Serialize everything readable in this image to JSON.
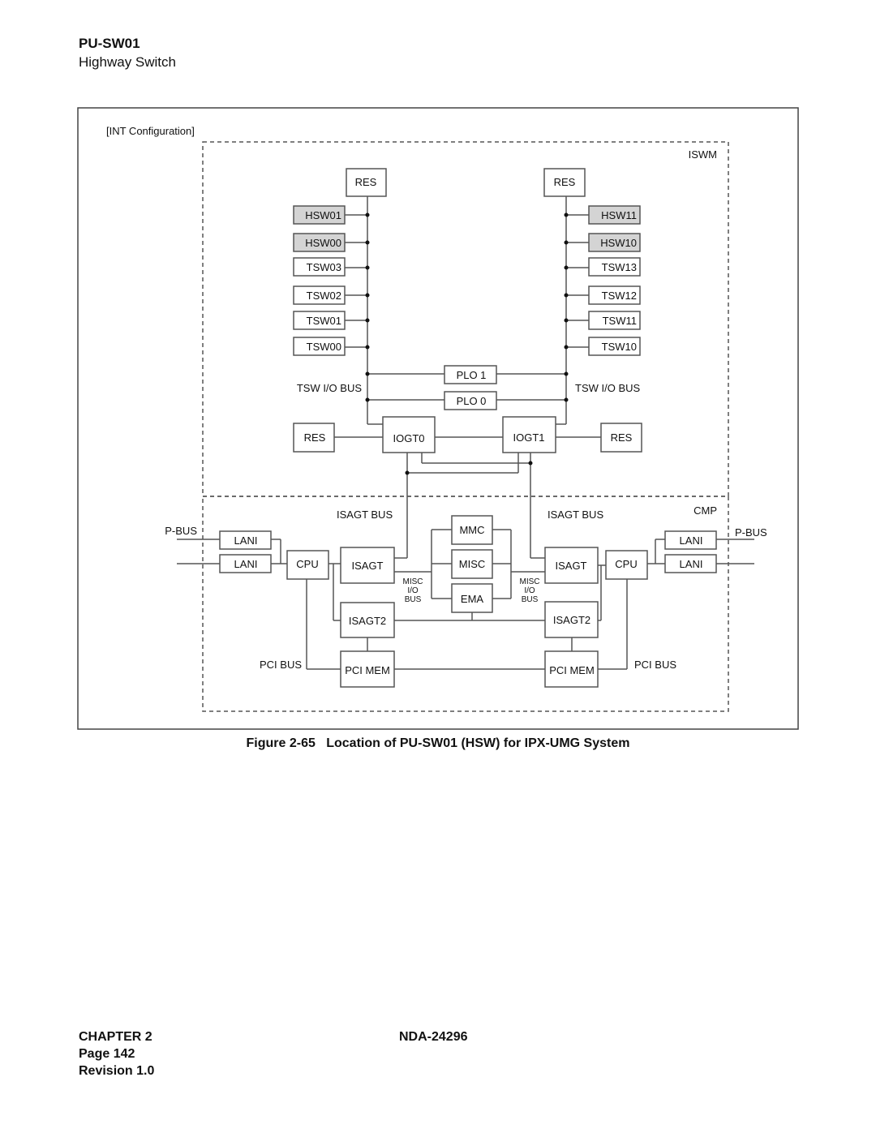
{
  "header": {
    "title": "PU-SW01",
    "subtitle": "Highway Switch"
  },
  "diagram": {
    "configuration_label": "[INT Configuration]",
    "regions": {
      "iswm": "ISWM",
      "cmp": "CMP"
    },
    "iswm": {
      "left_res": "RES",
      "right_res": "RES",
      "left_switches": [
        {
          "label": "HSW01",
          "highlighted": true
        },
        {
          "label": "HSW00",
          "highlighted": true
        },
        {
          "label": "TSW03",
          "highlighted": false
        },
        {
          "label": "TSW02",
          "highlighted": false
        },
        {
          "label": "TSW01",
          "highlighted": false
        },
        {
          "label": "TSW00",
          "highlighted": false
        }
      ],
      "right_switches": [
        {
          "label": "HSW11",
          "highlighted": true
        },
        {
          "label": "HSW10",
          "highlighted": true
        },
        {
          "label": "TSW13",
          "highlighted": false
        },
        {
          "label": "TSW12",
          "highlighted": false
        },
        {
          "label": "TSW11",
          "highlighted": false
        },
        {
          "label": "TSW10",
          "highlighted": false
        }
      ],
      "plo1": "PLO 1",
      "plo0": "PLO 0",
      "tsw_io_bus_left": "TSW I/O BUS",
      "tsw_io_bus_right": "TSW I/O BUS",
      "iogt0": "IOGT0",
      "iogt1": "IOGT1",
      "iogt0_res": "RES",
      "iogt1_res": "RES"
    },
    "cmp": {
      "isagt_bus_left": "ISAGT BUS",
      "isagt_bus_right": "ISAGT BUS",
      "pbus_left": "P-BUS",
      "pbus_right": "P-BUS",
      "lani_left_top": "LANI",
      "lani_left_bottom": "LANI",
      "lani_right_top": "LANI",
      "lani_right_bottom": "LANI",
      "cpu_left": "CPU",
      "cpu_right": "CPU",
      "isagt_left": "ISAGT",
      "isagt_right": "ISAGT",
      "mmc": "MMC",
      "misc": "MISC",
      "ema": "EMA",
      "misc_io_bus_left": [
        "MISC",
        "I/O",
        "BUS"
      ],
      "misc_io_bus_right": [
        "MISC",
        "I/O",
        "BUS"
      ],
      "isagt2_left": "ISAGT2",
      "isagt2_right": "ISAGT2",
      "pci_bus_left": "PCI BUS",
      "pci_bus_right": "PCI BUS",
      "pci_mem_left": "PCI MEM",
      "pci_mem_right": "PCI MEM"
    }
  },
  "caption": "Figure 2-65   Location of PU-SW01 (HSW) for IPX-UMG System",
  "footer": {
    "chapter": "CHAPTER 2",
    "page": "Page 142",
    "revision": "Revision 1.0",
    "doc_number": "NDA-24296"
  },
  "colors": {
    "highlight_fill": "#d4d4d4",
    "line": "#555555"
  }
}
